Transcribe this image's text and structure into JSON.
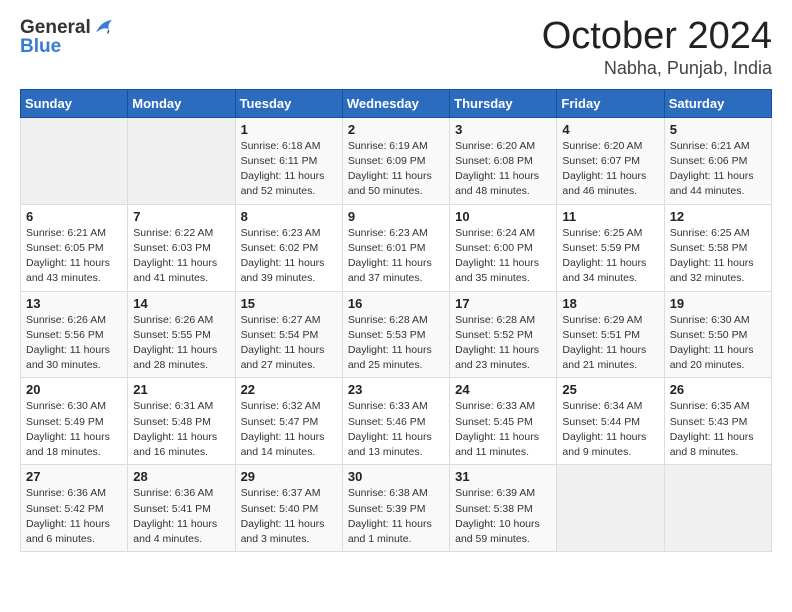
{
  "header": {
    "logo_general": "General",
    "logo_blue": "Blue",
    "month": "October 2024",
    "location": "Nabha, Punjab, India"
  },
  "weekdays": [
    "Sunday",
    "Monday",
    "Tuesday",
    "Wednesday",
    "Thursday",
    "Friday",
    "Saturday"
  ],
  "weeks": [
    [
      {
        "day": "",
        "sunrise": "",
        "sunset": "",
        "daylight": ""
      },
      {
        "day": "",
        "sunrise": "",
        "sunset": "",
        "daylight": ""
      },
      {
        "day": "1",
        "sunrise": "Sunrise: 6:18 AM",
        "sunset": "Sunset: 6:11 PM",
        "daylight": "Daylight: 11 hours and 52 minutes."
      },
      {
        "day": "2",
        "sunrise": "Sunrise: 6:19 AM",
        "sunset": "Sunset: 6:09 PM",
        "daylight": "Daylight: 11 hours and 50 minutes."
      },
      {
        "day": "3",
        "sunrise": "Sunrise: 6:20 AM",
        "sunset": "Sunset: 6:08 PM",
        "daylight": "Daylight: 11 hours and 48 minutes."
      },
      {
        "day": "4",
        "sunrise": "Sunrise: 6:20 AM",
        "sunset": "Sunset: 6:07 PM",
        "daylight": "Daylight: 11 hours and 46 minutes."
      },
      {
        "day": "5",
        "sunrise": "Sunrise: 6:21 AM",
        "sunset": "Sunset: 6:06 PM",
        "daylight": "Daylight: 11 hours and 44 minutes."
      }
    ],
    [
      {
        "day": "6",
        "sunrise": "Sunrise: 6:21 AM",
        "sunset": "Sunset: 6:05 PM",
        "daylight": "Daylight: 11 hours and 43 minutes."
      },
      {
        "day": "7",
        "sunrise": "Sunrise: 6:22 AM",
        "sunset": "Sunset: 6:03 PM",
        "daylight": "Daylight: 11 hours and 41 minutes."
      },
      {
        "day": "8",
        "sunrise": "Sunrise: 6:23 AM",
        "sunset": "Sunset: 6:02 PM",
        "daylight": "Daylight: 11 hours and 39 minutes."
      },
      {
        "day": "9",
        "sunrise": "Sunrise: 6:23 AM",
        "sunset": "Sunset: 6:01 PM",
        "daylight": "Daylight: 11 hours and 37 minutes."
      },
      {
        "day": "10",
        "sunrise": "Sunrise: 6:24 AM",
        "sunset": "Sunset: 6:00 PM",
        "daylight": "Daylight: 11 hours and 35 minutes."
      },
      {
        "day": "11",
        "sunrise": "Sunrise: 6:25 AM",
        "sunset": "Sunset: 5:59 PM",
        "daylight": "Daylight: 11 hours and 34 minutes."
      },
      {
        "day": "12",
        "sunrise": "Sunrise: 6:25 AM",
        "sunset": "Sunset: 5:58 PM",
        "daylight": "Daylight: 11 hours and 32 minutes."
      }
    ],
    [
      {
        "day": "13",
        "sunrise": "Sunrise: 6:26 AM",
        "sunset": "Sunset: 5:56 PM",
        "daylight": "Daylight: 11 hours and 30 minutes."
      },
      {
        "day": "14",
        "sunrise": "Sunrise: 6:26 AM",
        "sunset": "Sunset: 5:55 PM",
        "daylight": "Daylight: 11 hours and 28 minutes."
      },
      {
        "day": "15",
        "sunrise": "Sunrise: 6:27 AM",
        "sunset": "Sunset: 5:54 PM",
        "daylight": "Daylight: 11 hours and 27 minutes."
      },
      {
        "day": "16",
        "sunrise": "Sunrise: 6:28 AM",
        "sunset": "Sunset: 5:53 PM",
        "daylight": "Daylight: 11 hours and 25 minutes."
      },
      {
        "day": "17",
        "sunrise": "Sunrise: 6:28 AM",
        "sunset": "Sunset: 5:52 PM",
        "daylight": "Daylight: 11 hours and 23 minutes."
      },
      {
        "day": "18",
        "sunrise": "Sunrise: 6:29 AM",
        "sunset": "Sunset: 5:51 PM",
        "daylight": "Daylight: 11 hours and 21 minutes."
      },
      {
        "day": "19",
        "sunrise": "Sunrise: 6:30 AM",
        "sunset": "Sunset: 5:50 PM",
        "daylight": "Daylight: 11 hours and 20 minutes."
      }
    ],
    [
      {
        "day": "20",
        "sunrise": "Sunrise: 6:30 AM",
        "sunset": "Sunset: 5:49 PM",
        "daylight": "Daylight: 11 hours and 18 minutes."
      },
      {
        "day": "21",
        "sunrise": "Sunrise: 6:31 AM",
        "sunset": "Sunset: 5:48 PM",
        "daylight": "Daylight: 11 hours and 16 minutes."
      },
      {
        "day": "22",
        "sunrise": "Sunrise: 6:32 AM",
        "sunset": "Sunset: 5:47 PM",
        "daylight": "Daylight: 11 hours and 14 minutes."
      },
      {
        "day": "23",
        "sunrise": "Sunrise: 6:33 AM",
        "sunset": "Sunset: 5:46 PM",
        "daylight": "Daylight: 11 hours and 13 minutes."
      },
      {
        "day": "24",
        "sunrise": "Sunrise: 6:33 AM",
        "sunset": "Sunset: 5:45 PM",
        "daylight": "Daylight: 11 hours and 11 minutes."
      },
      {
        "day": "25",
        "sunrise": "Sunrise: 6:34 AM",
        "sunset": "Sunset: 5:44 PM",
        "daylight": "Daylight: 11 hours and 9 minutes."
      },
      {
        "day": "26",
        "sunrise": "Sunrise: 6:35 AM",
        "sunset": "Sunset: 5:43 PM",
        "daylight": "Daylight: 11 hours and 8 minutes."
      }
    ],
    [
      {
        "day": "27",
        "sunrise": "Sunrise: 6:36 AM",
        "sunset": "Sunset: 5:42 PM",
        "daylight": "Daylight: 11 hours and 6 minutes."
      },
      {
        "day": "28",
        "sunrise": "Sunrise: 6:36 AM",
        "sunset": "Sunset: 5:41 PM",
        "daylight": "Daylight: 11 hours and 4 minutes."
      },
      {
        "day": "29",
        "sunrise": "Sunrise: 6:37 AM",
        "sunset": "Sunset: 5:40 PM",
        "daylight": "Daylight: 11 hours and 3 minutes."
      },
      {
        "day": "30",
        "sunrise": "Sunrise: 6:38 AM",
        "sunset": "Sunset: 5:39 PM",
        "daylight": "Daylight: 11 hours and 1 minute."
      },
      {
        "day": "31",
        "sunrise": "Sunrise: 6:39 AM",
        "sunset": "Sunset: 5:38 PM",
        "daylight": "Daylight: 10 hours and 59 minutes."
      },
      {
        "day": "",
        "sunrise": "",
        "sunset": "",
        "daylight": ""
      },
      {
        "day": "",
        "sunrise": "",
        "sunset": "",
        "daylight": ""
      }
    ]
  ]
}
